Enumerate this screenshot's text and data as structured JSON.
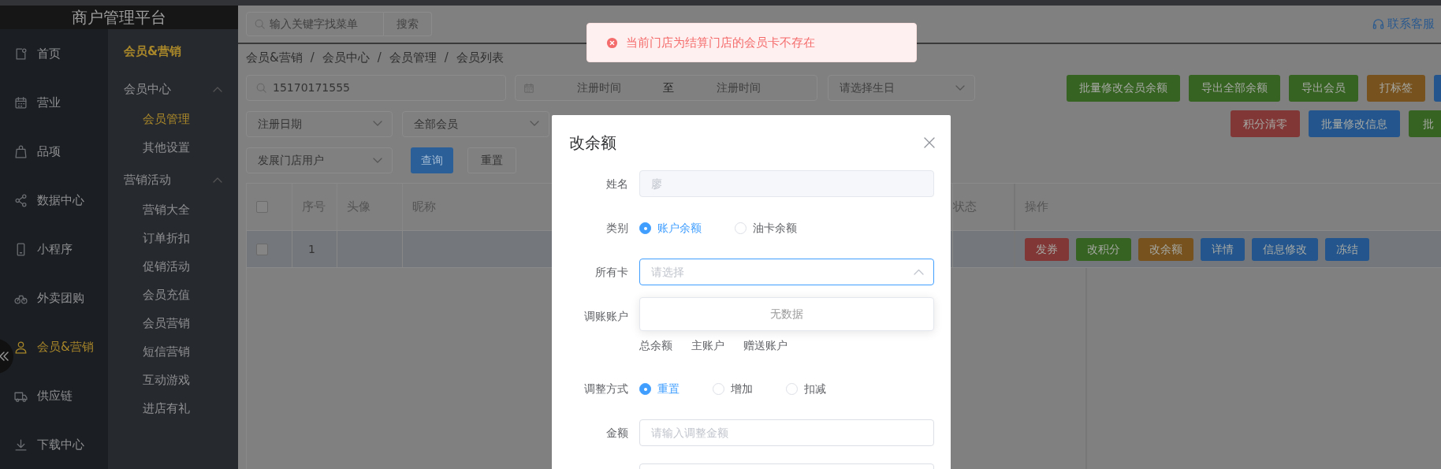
{
  "app": {
    "title": "商户管理平台"
  },
  "main_nav": [
    {
      "label": "首页",
      "selected": false
    },
    {
      "label": "营业",
      "selected": false
    },
    {
      "label": "品项",
      "selected": false
    },
    {
      "label": "数据中心",
      "selected": false
    },
    {
      "label": "小程序",
      "selected": false
    },
    {
      "label": "外卖团购",
      "selected": false
    },
    {
      "label": "会员&营销",
      "selected": true
    },
    {
      "label": "供应链",
      "selected": false
    },
    {
      "label": "下载中心",
      "selected": false
    }
  ],
  "sub_nav": {
    "title": "会员&营销",
    "groups": [
      {
        "label": "会员中心",
        "expanded": true,
        "children": [
          {
            "label": "会员管理",
            "selected": true
          },
          {
            "label": "其他设置",
            "selected": false
          }
        ]
      },
      {
        "label": "营销活动",
        "expanded": true,
        "children": [
          {
            "label": "营销大全",
            "selected": false
          },
          {
            "label": "订单折扣",
            "selected": false
          },
          {
            "label": "促销活动",
            "selected": false
          },
          {
            "label": "会员充值",
            "selected": false
          },
          {
            "label": "会员营销",
            "selected": false
          },
          {
            "label": "短信营销",
            "selected": false
          },
          {
            "label": "互动游戏",
            "selected": false
          },
          {
            "label": "进店有礼",
            "selected": false
          }
        ]
      }
    ]
  },
  "header": {
    "search": {
      "placeholder": "输入关键字找菜单",
      "button": "搜索"
    },
    "support": "联系客服"
  },
  "breadcrumb": {
    "separator": "/",
    "items": [
      "会员&营销",
      "会员中心",
      "会员管理",
      "会员列表"
    ]
  },
  "filters": {
    "keyword": "15170171555",
    "date_start_placeholder": "注册时间",
    "date_separator": "至",
    "date_end_placeholder": "注册时间",
    "birthday_placeholder": "请选择生日",
    "date_type": "注册日期",
    "member_type": "全部会员",
    "store": "发展门店用户",
    "query": "查询",
    "reset": "重置"
  },
  "toolbar_rows": [
    [
      {
        "label": "批量修改会员余额",
        "color": "#366321"
      },
      {
        "label": "导出全部余额",
        "color": "#366321"
      },
      {
        "label": "导出会员",
        "color": "#366321"
      },
      {
        "label": "打标签",
        "color": "#77521f"
      },
      {
        "color": "#24558c"
      }
    ],
    [
      {
        "label": "积分清零",
        "color": "#803736"
      },
      {
        "label": "批量修改信息",
        "color": "#24558c"
      },
      {
        "label": "批",
        "color": "#366321"
      }
    ]
  ],
  "table": {
    "select_all": {
      "checked": false
    },
    "columns": [
      {
        "label": "序号"
      },
      {
        "label": "头像"
      },
      {
        "label": "昵称"
      },
      {
        "label": "状态"
      },
      {
        "label": "操作"
      }
    ],
    "rows": [
      {
        "checked": false,
        "index": "1",
        "actions": [
          {
            "label": "发券",
            "color": "#803736"
          },
          {
            "label": "改积分",
            "color": "#366321"
          },
          {
            "label": "改余额",
            "color": "#77521f"
          },
          {
            "label": "详情",
            "color": "#24558c"
          },
          {
            "label": "信息修改",
            "color": "#24558c"
          },
          {
            "label": "冻结",
            "color": "#24558c"
          }
        ]
      }
    ]
  },
  "dialog": {
    "title": "改余额",
    "fields": [
      {
        "kind": "text",
        "label": "姓名",
        "value": "廖",
        "disabled": true
      },
      {
        "kind": "radio",
        "label": "类别",
        "options": [
          {
            "label": "账户余额",
            "selected": true
          },
          {
            "label": "油卡余额",
            "selected": false
          }
        ]
      },
      {
        "kind": "select",
        "label": "所有卡",
        "placeholder": "请选择",
        "expanded": true,
        "empty_text": "无数据"
      },
      {
        "kind": "accounts",
        "label": "调账账户",
        "items": [
          "总余额",
          "主账户",
          "赠送账户"
        ]
      },
      {
        "kind": "radio",
        "label": "调整方式",
        "options": [
          {
            "label": "重置",
            "selected": true
          },
          {
            "label": "增加",
            "selected": false
          },
          {
            "label": "扣减",
            "selected": false
          }
        ]
      },
      {
        "kind": "text",
        "label": "金额",
        "placeholder": "请输入调整金额"
      },
      {
        "kind": "text"
      }
    ]
  },
  "toast": {
    "kind": "error",
    "message": "当前门店为结算门店的会员卡不存在"
  }
}
